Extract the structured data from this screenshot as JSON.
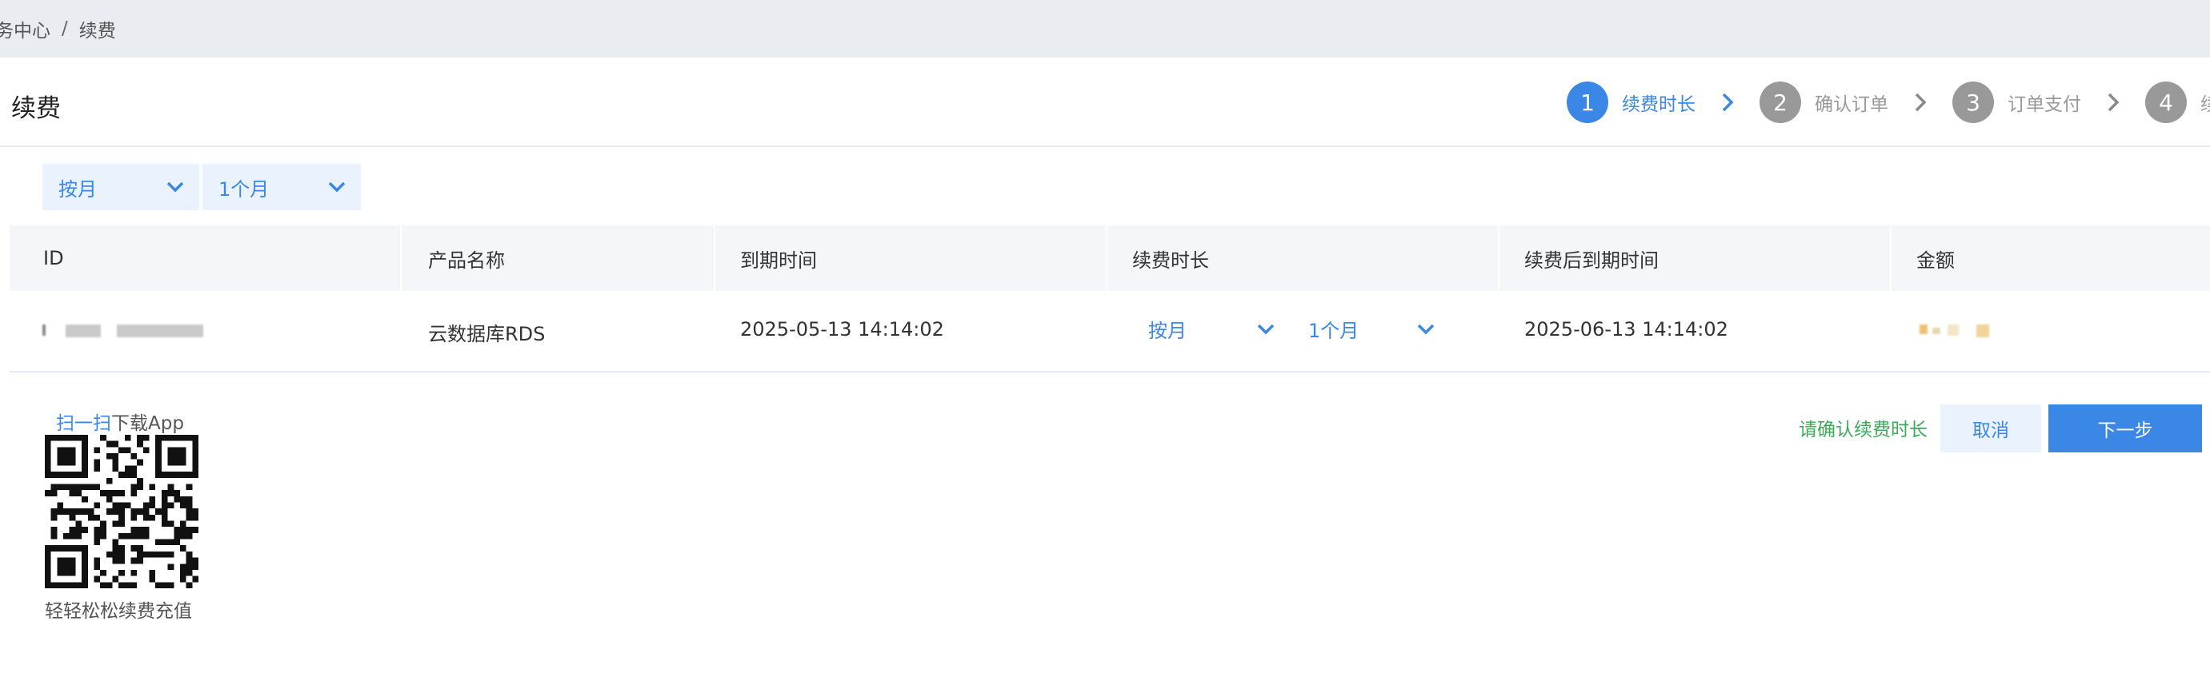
{
  "breadcrumb": {
    "parent": "务中心",
    "separator": "/",
    "current": "续费"
  },
  "page_title": "续费",
  "steps": [
    {
      "num": "1",
      "label": "续费时长",
      "active": true
    },
    {
      "num": "2",
      "label": "确认订单",
      "active": false
    },
    {
      "num": "3",
      "label": "订单支付",
      "active": false
    },
    {
      "num": "4",
      "label": "续费成功",
      "active": false
    }
  ],
  "filters": {
    "unit": "按月",
    "length": "1个月"
  },
  "table": {
    "headers": [
      "ID",
      "产品名称",
      "到期时间",
      "续费时长",
      "续费后到期时间",
      "金额"
    ],
    "row": {
      "product": "云数据库RDS",
      "expire": "2025-05-13 14:14:02",
      "unit": "按月",
      "length": "1个月",
      "new_expire": "2025-06-13 14:14:02"
    }
  },
  "app": {
    "scan_link": "扫一扫",
    "scan_text": "下载App",
    "caption": "轻轻松松续费充值"
  },
  "actions": {
    "message": "请确认续费时长",
    "cancel": "取消",
    "next": "下一步"
  },
  "colors": {
    "accent": "#3a87e6",
    "success": "#3daa5a",
    "inactive_step": "#999999"
  }
}
